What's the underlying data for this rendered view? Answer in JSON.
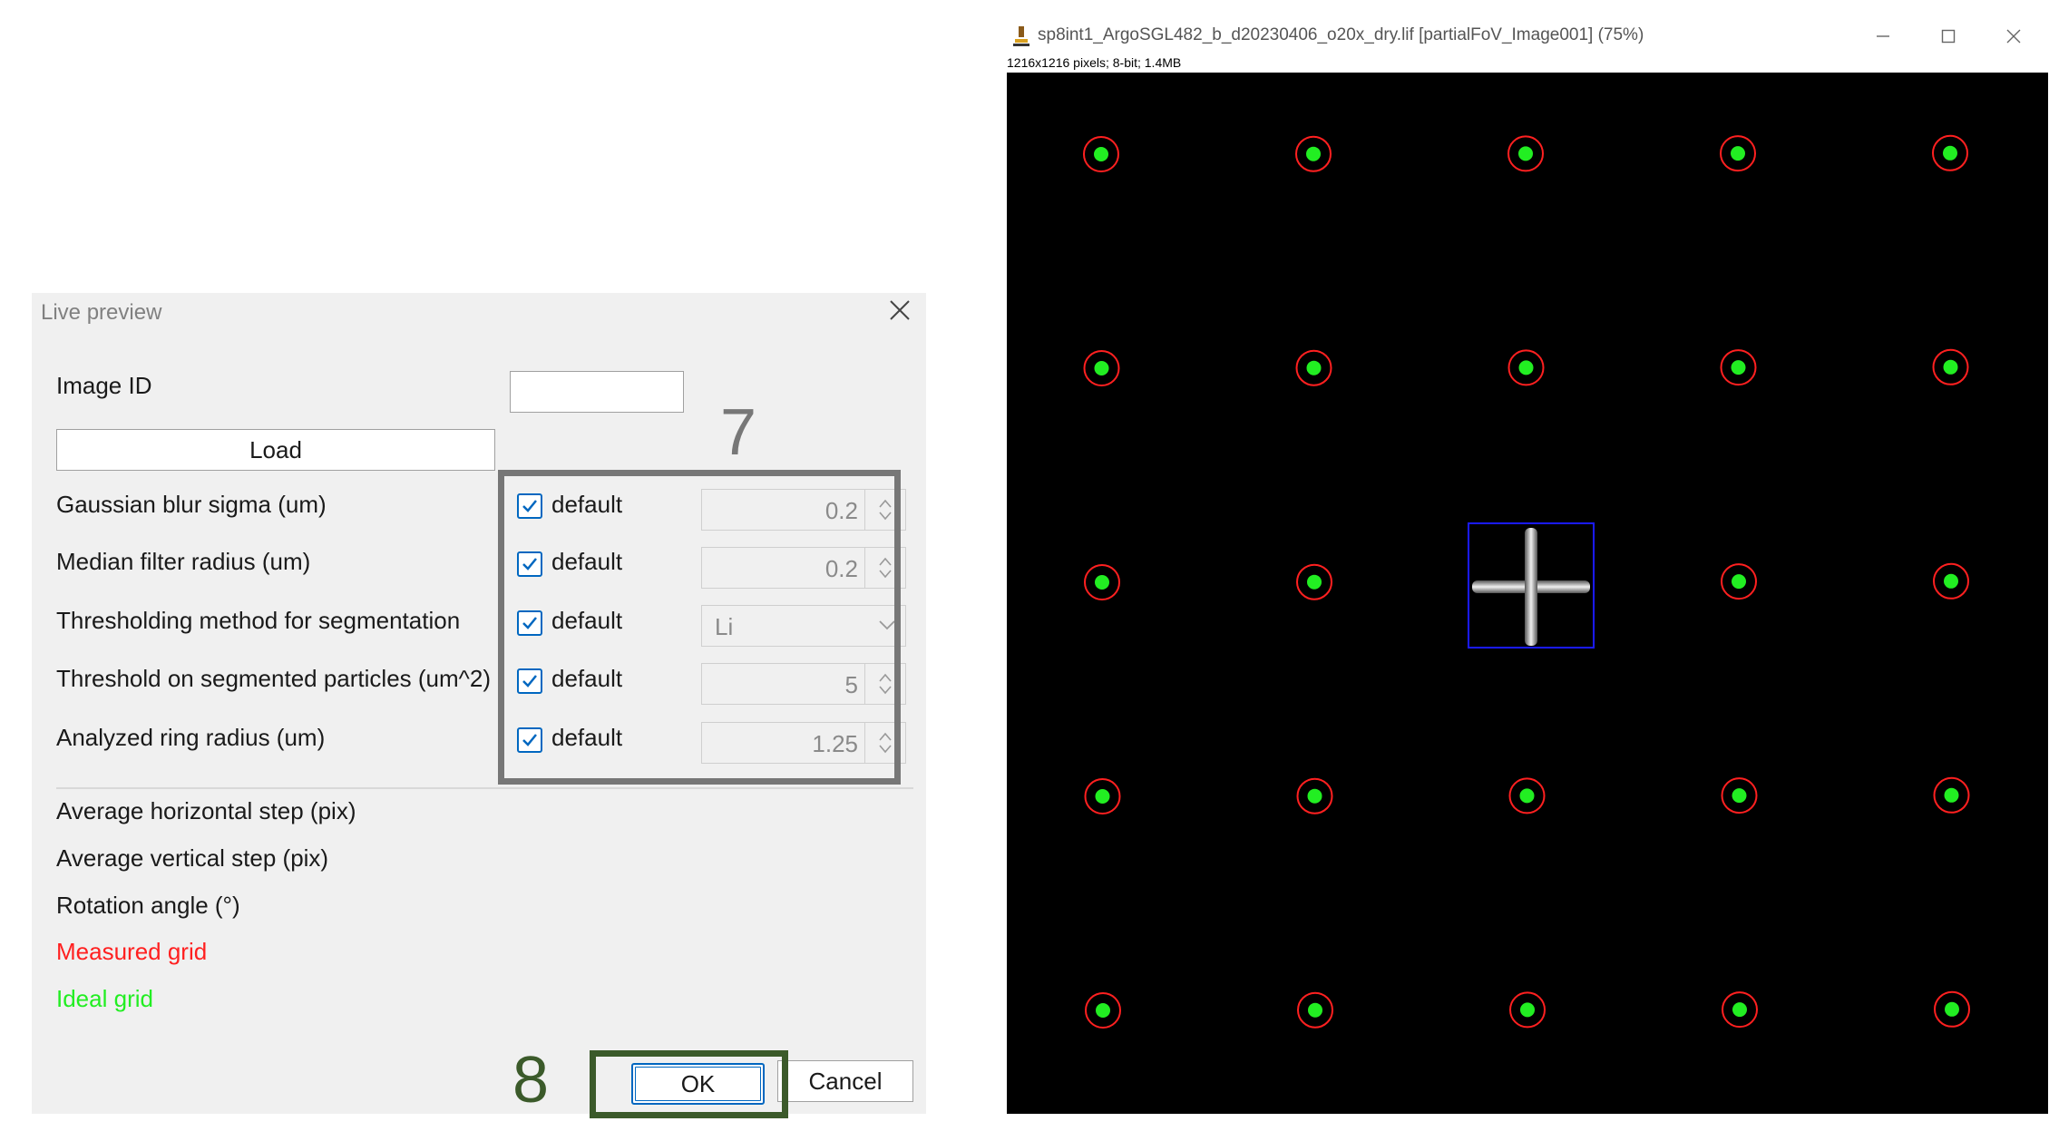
{
  "dialog": {
    "title": "Live preview",
    "image_id": {
      "label": "Image ID",
      "value": ""
    },
    "load_label": "Load",
    "params": [
      {
        "label": "Gaussian blur sigma (um)",
        "checkbox_label": "default",
        "checked": true,
        "control": "spinner",
        "value": "0.2"
      },
      {
        "label": "Median filter radius (um)",
        "checkbox_label": "default",
        "checked": true,
        "control": "spinner",
        "value": "0.2"
      },
      {
        "label": "Thresholding method for segmentation",
        "checkbox_label": "default",
        "checked": true,
        "control": "select",
        "value": "Li"
      },
      {
        "label": "Threshold on segmented particles (um^2)",
        "checkbox_label": "default",
        "checked": true,
        "control": "spinner",
        "value": "5"
      },
      {
        "label": "Analyzed ring radius (um)",
        "checkbox_label": "default",
        "checked": true,
        "control": "spinner",
        "value": "1.25"
      }
    ],
    "results": [
      {
        "label": "Average horizontal step (pix)"
      },
      {
        "label": "Average vertical step (pix)"
      },
      {
        "label": "Rotation angle (°)"
      }
    ],
    "legend": [
      {
        "label": "Measured grid",
        "color": "#ff2020"
      },
      {
        "label": "Ideal grid",
        "color": "#22ee22"
      }
    ],
    "ok_label": "OK",
    "cancel_label": "Cancel"
  },
  "annotations": {
    "step_config": "7",
    "step_ok": "8"
  },
  "image_window": {
    "title": "sp8int1_ArgoSGL482_b_d20230406_o20x_dry.lif [partialFoV_Image001] (75%)",
    "info": "1216x1216 pixels; 8-bit; 1.4MB",
    "grid": {
      "rows": 5,
      "cols": 5
    },
    "colors": {
      "measured": "#ff2020",
      "ideal": "#22ee22",
      "roi": "#1a1aff",
      "background": "#000000"
    }
  }
}
